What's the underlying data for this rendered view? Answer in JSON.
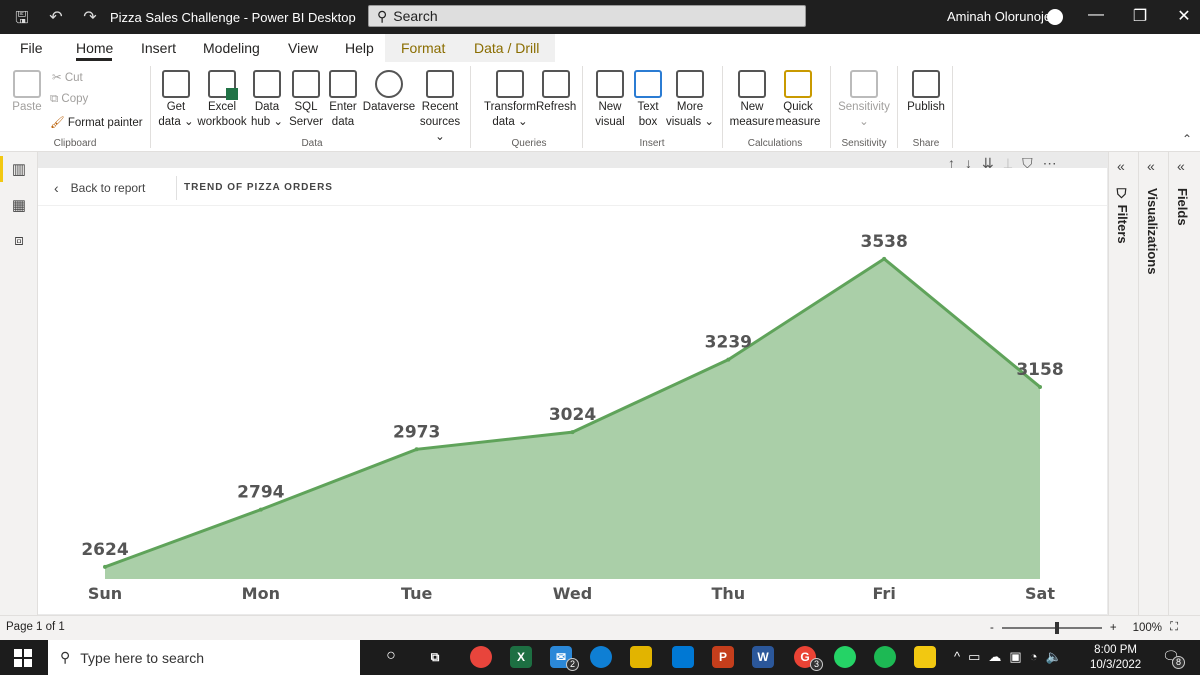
{
  "window": {
    "title": "Pizza Sales Challenge - Power BI Desktop",
    "search_label": "Search",
    "user_name": "Aminah Olorunoje"
  },
  "menu": {
    "tabs": [
      "File",
      "Home",
      "Insert",
      "Modeling",
      "View",
      "Help"
    ],
    "contextual_tabs": [
      "Format",
      "Data / Drill"
    ]
  },
  "ribbon": {
    "clipboard": {
      "paste": "Paste",
      "cut": "Cut",
      "copy": "Copy",
      "format_painter": "Format painter",
      "label": "Clipboard"
    },
    "data": {
      "get_data": [
        "Get",
        "data ⌄"
      ],
      "excel": [
        "Excel",
        "workbook"
      ],
      "data_hub": [
        "Data",
        "hub ⌄"
      ],
      "sql": [
        "SQL",
        "Server"
      ],
      "enter_data": [
        "Enter",
        "data"
      ],
      "dataverse": [
        "Dataverse",
        ""
      ],
      "recent": [
        "Recent",
        "sources ⌄"
      ],
      "label": "Data"
    },
    "queries": {
      "transform": [
        "Transform",
        "data ⌄"
      ],
      "refresh": [
        "Refresh",
        ""
      ],
      "label": "Queries"
    },
    "insert": {
      "new_visual": [
        "New",
        "visual"
      ],
      "text_box": [
        "Text",
        "box"
      ],
      "more_visuals": [
        "More",
        "visuals ⌄"
      ],
      "label": "Insert"
    },
    "calculations": {
      "new_measure": [
        "New",
        "measure"
      ],
      "quick_measure": [
        "Quick",
        "measure"
      ],
      "label": "Calculations"
    },
    "sensitivity": {
      "button": [
        "Sensitivity",
        "⌄"
      ],
      "label": "Sensitivity"
    },
    "share": {
      "publish": [
        "Publish",
        ""
      ],
      "label": "Share"
    }
  },
  "report": {
    "back_label": "Back to report",
    "title": "TREND OF PIZZA ORDERS"
  },
  "panes": {
    "filters": "Filters",
    "visualizations": "Visualizations",
    "fields": "Fields"
  },
  "status": {
    "page": "Page 1 of 1",
    "zoom": "100%",
    "zoom_fraction": 0.55
  },
  "taskbar": {
    "search_placeholder": "Type here to search",
    "time": "8:00 PM",
    "date": "10/3/2022",
    "mail_badge": "2",
    "chrome_badge": "3",
    "notif_count": "8"
  },
  "chart_data": {
    "type": "area",
    "categories": [
      "Sun",
      "Mon",
      "Tue",
      "Wed",
      "Thu",
      "Fri",
      "Sat"
    ],
    "values": [
      2624,
      2794,
      2973,
      3024,
      3239,
      3538,
      3158
    ],
    "ylim": [
      2600,
      3600
    ],
    "data_labels": true,
    "grid": false,
    "fill_color": "#aacfa8",
    "line_color": "#5fa35a"
  }
}
